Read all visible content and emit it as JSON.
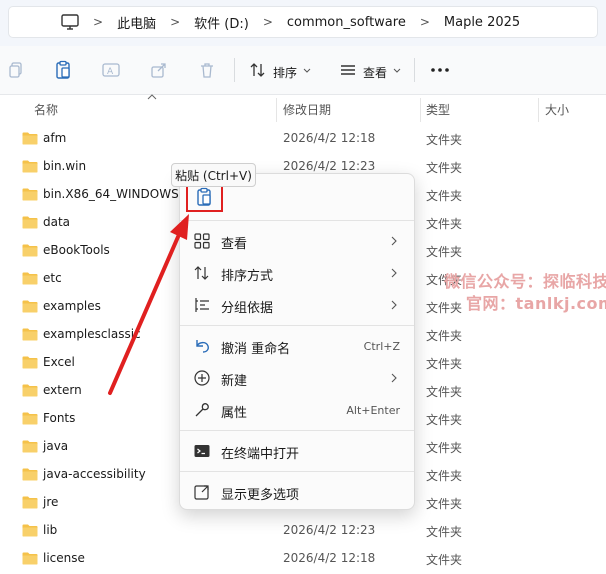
{
  "address_bar": {
    "crumbs": [
      "此电脑",
      "软件 (D:)",
      "common_software",
      "Maple 2025"
    ]
  },
  "toolbar": {
    "sort_label": "排序",
    "view_label": "查看"
  },
  "columns": {
    "name": "名称",
    "date": "修改日期",
    "type": "类型",
    "size": "大小"
  },
  "files": [
    {
      "name": "afm",
      "date": "2026/4/2 12:18",
      "type": "文件夹"
    },
    {
      "name": "bin.win",
      "date": "2026/4/2 12:23",
      "type": "文件夹"
    },
    {
      "name": "bin.X86_64_WINDOWS",
      "date": "",
      "type": "文件夹"
    },
    {
      "name": "data",
      "date": "",
      "type": "文件夹"
    },
    {
      "name": "eBookTools",
      "date": "",
      "type": "文件夹"
    },
    {
      "name": "etc",
      "date": "",
      "type": "文件夹"
    },
    {
      "name": "examples",
      "date": "",
      "type": "文件夹"
    },
    {
      "name": "examplesclassic",
      "date": "",
      "type": "文件夹"
    },
    {
      "name": "Excel",
      "date": "",
      "type": "文件夹"
    },
    {
      "name": "extern",
      "date": "",
      "type": "文件夹"
    },
    {
      "name": "Fonts",
      "date": "",
      "type": "文件夹"
    },
    {
      "name": "java",
      "date": "",
      "type": "文件夹"
    },
    {
      "name": "java-accessibility",
      "date": "",
      "type": "文件夹"
    },
    {
      "name": "jre",
      "date": "",
      "type": "文件夹"
    },
    {
      "name": "lib",
      "date": "2026/4/2 12:23",
      "type": "文件夹"
    },
    {
      "name": "license",
      "date": "2026/4/2 12:18",
      "type": "文件夹"
    }
  ],
  "tooltip": {
    "text": "粘贴 (Ctrl+V)"
  },
  "context_menu": {
    "view": "查看",
    "sort_by": "排序方式",
    "group_by": "分组依据",
    "undo_rename": "撤消 重命名",
    "undo_shortcut": "Ctrl+Z",
    "new": "新建",
    "properties": "属性",
    "properties_shortcut": "Alt+Enter",
    "open_terminal": "在终端中打开",
    "show_more": "显示更多选项"
  },
  "watermark": {
    "line1": "微信公众号：探临科技",
    "line2": "官网：tanlkj.com"
  },
  "colors": {
    "folder": "#f5c24a",
    "accent": "#0067c0",
    "highlight_box": "#e02020",
    "arrow": "#e02020"
  }
}
